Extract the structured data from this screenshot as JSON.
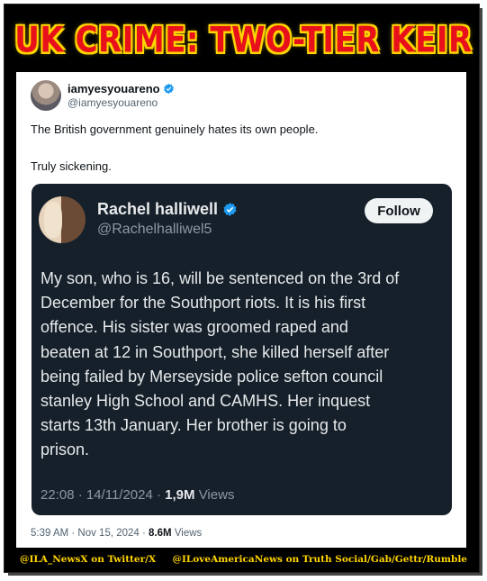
{
  "banner": {
    "title": "UK CRIME: TWO-TIER KEIR"
  },
  "tweet": {
    "display_name": "iamyesyouareno",
    "handle": "@iamyesyouareno",
    "text_line1": "The British government genuinely hates its own people.",
    "text_line2": "Truly sickening.",
    "timestamp": "5:39 AM · Nov 15, 2024 · ",
    "views_count": "8.6M",
    "views_label": " Views"
  },
  "quoted_tweet": {
    "display_name": "Rachel halliwell",
    "handle": "@Rachelhalliwel5",
    "follow_label": "Follow",
    "body": "My son, who is 16, will be sentenced on the 3rd of\nDecember for the Southport riots. It is his first\noffence.   His sister was groomed raped and\nbeaten at 12 in Southport, she killed herself after\nbeing failed by Merseyside police sefton council\nstanley High School and CAMHS.  Her inquest\nstarts 13th January.  Her brother is going to\nprison.",
    "timestamp": "22:08 · 14/11/2024 · ",
    "views_count": "1,9M",
    "views_label": " Views"
  },
  "footer": {
    "left": "@ILA_NewsX on Twitter/X",
    "right": "@ILoveAmericaNews on Truth Social/Gab/Gettr/Rumble"
  },
  "colors": {
    "banner_text": "#e8111b",
    "banner_glow": "#ffd400",
    "quote_bg": "#15202b",
    "verified": "#1d9bf0",
    "footer_text": "#ffd400"
  }
}
